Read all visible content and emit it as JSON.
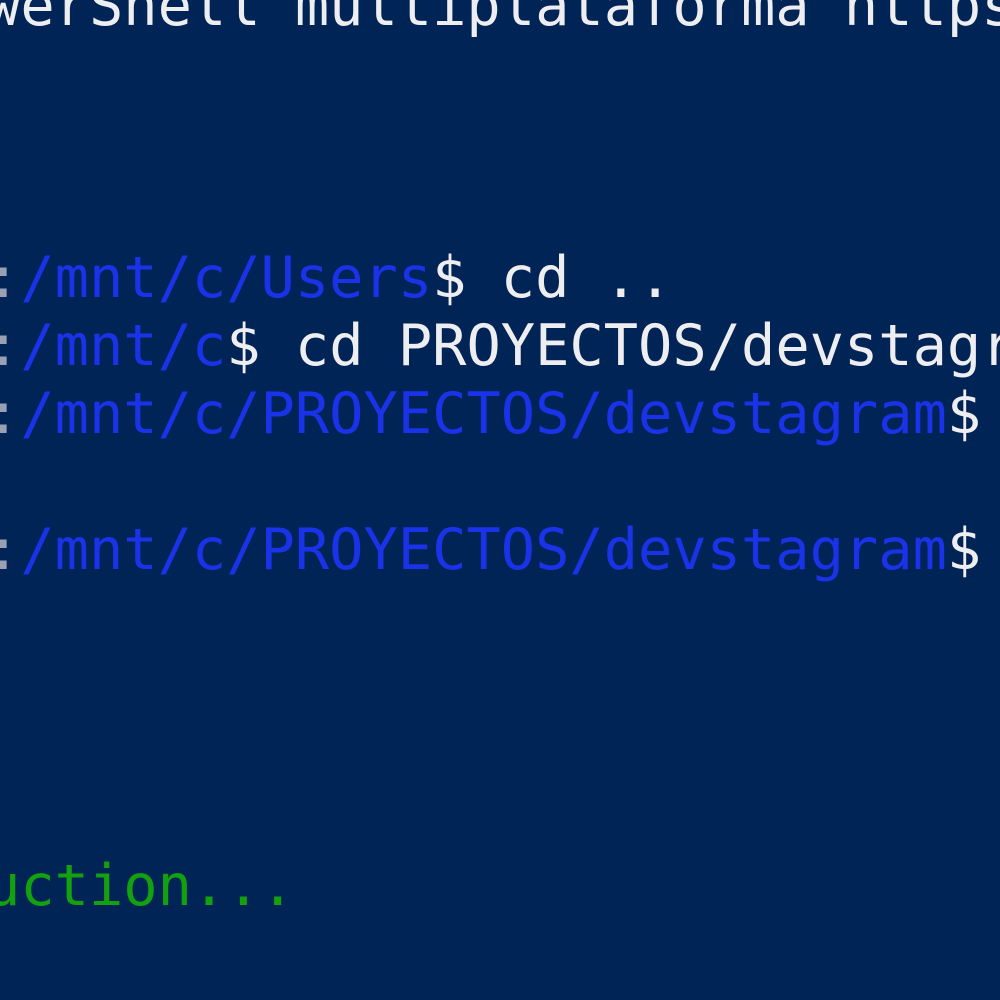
{
  "terminal": {
    "banner": "werShell multiplataforma https",
    "lines": [
      {
        "sep": ":",
        "path": "/mnt/c/Users",
        "prompt": "$",
        "command": " cd .."
      },
      {
        "sep": ":",
        "path": "/mnt/c",
        "prompt": "$",
        "command": " cd PROYECTOS/devstagr"
      },
      {
        "sep": ":",
        "path": "/mnt/c/PROYECTOS/devstagram",
        "prompt": "$",
        "command": " ."
      },
      {
        "sep": ":",
        "path": "/mnt/c/PROYECTOS/devstagram",
        "prompt": "$",
        "command": " ."
      }
    ],
    "status": "uction..."
  },
  "colors": {
    "background": "#012456",
    "path": "#1a33e8",
    "text": "#eeedf0",
    "success": "#13a10e"
  }
}
